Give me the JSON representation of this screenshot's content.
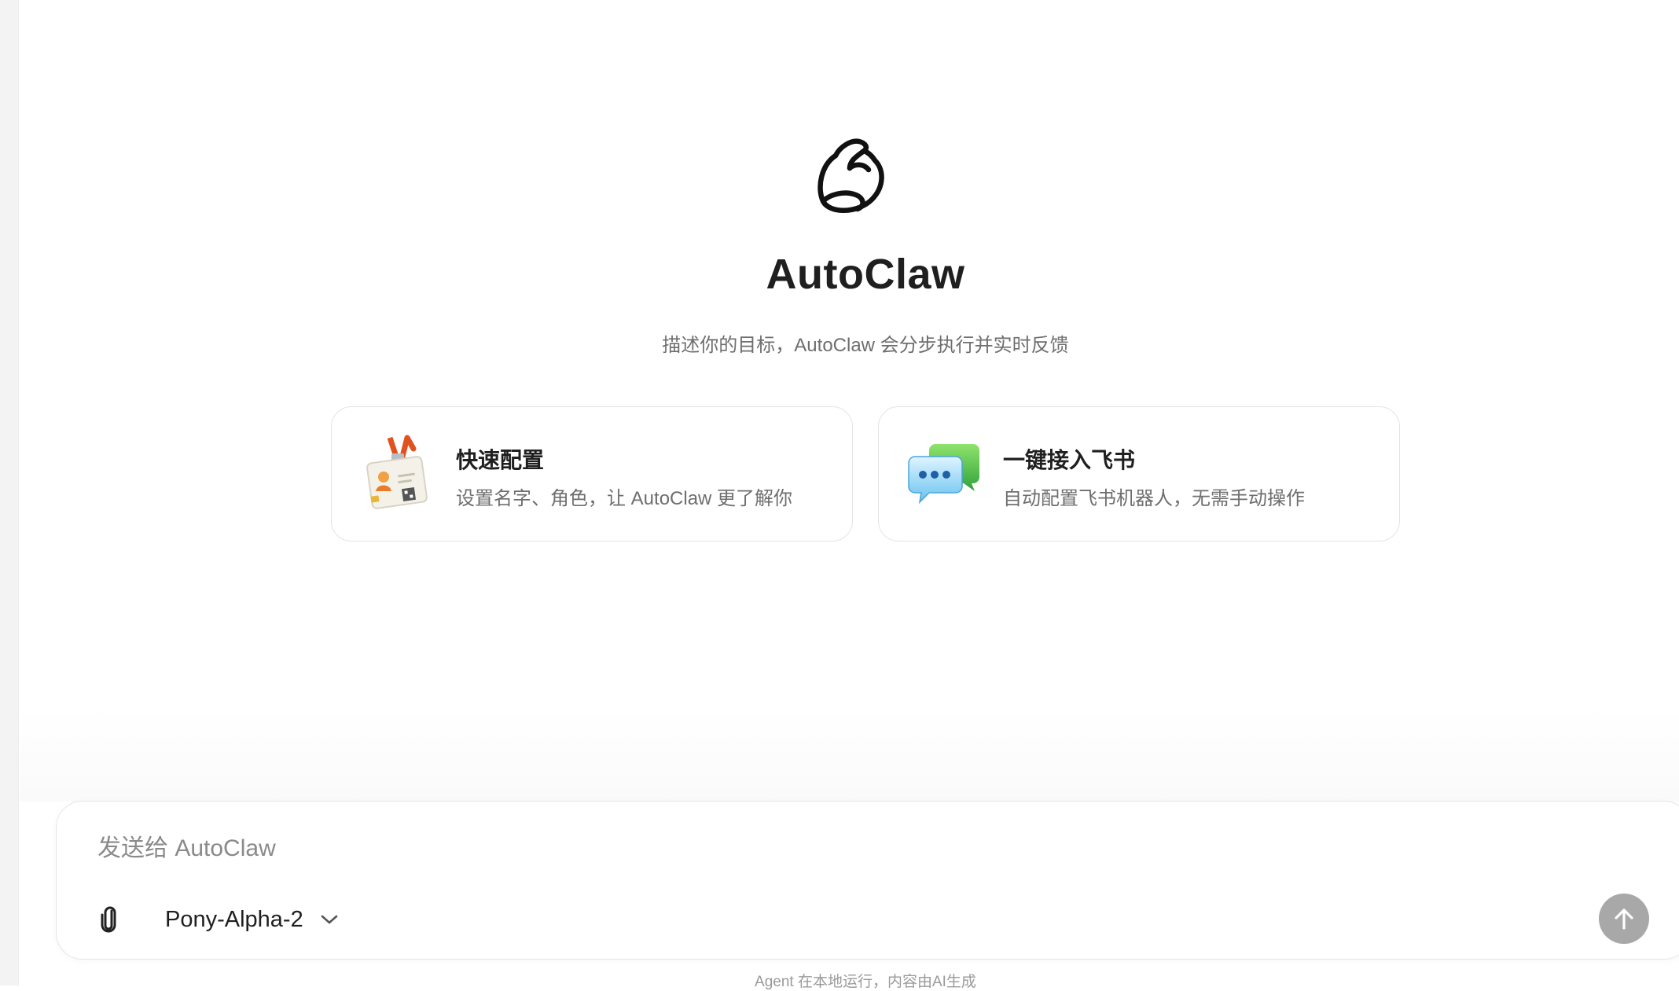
{
  "app": {
    "title": "AutoClaw",
    "subtitle": "描述你的目标，AutoClaw 会分步执行并实时反馈",
    "logo_icon": "claw-logo-icon"
  },
  "cards": [
    {
      "title": "快速配置",
      "description": "设置名字、角色，让 AutoClaw 更了解你",
      "icon": "id-badge-icon"
    },
    {
      "title": "一键接入飞书",
      "description": "自动配置飞书机器人，无需手动操作",
      "icon": "chat-bubbles-icon"
    }
  ],
  "composer": {
    "placeholder": "发送给 AutoClaw",
    "value": "",
    "model": "Pony-Alpha-2",
    "attach_icon": "paperclip-icon",
    "send_icon": "arrow-up-icon",
    "dropdown_icon": "chevron-down-icon"
  },
  "footer": {
    "disclaimer": "Agent 在本地运行，内容由AI生成"
  },
  "colors": {
    "send_button": "#a8a8a8",
    "text_primary": "#1f1f1f",
    "text_secondary": "#6e6e6e"
  }
}
